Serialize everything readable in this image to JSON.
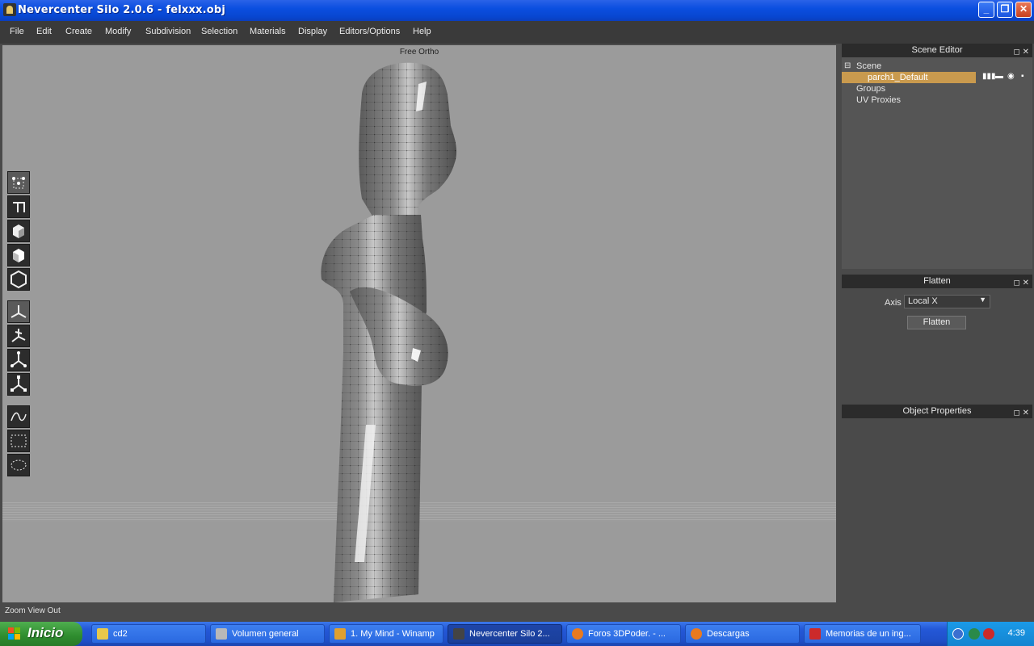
{
  "window": {
    "title": "Nevercenter Silo 2.0.6 - felxxx.obj"
  },
  "menu": [
    "File",
    "Edit",
    "Create",
    "Modify",
    "Subdivision",
    "Selection",
    "Materials",
    "Display",
    "Editors/Options",
    "Help"
  ],
  "viewport": {
    "label": "Free Ortho"
  },
  "scene_editor": {
    "title": "Scene Editor",
    "items": [
      {
        "label": "Scene",
        "toggle": "⊟"
      },
      {
        "label": "parch1_Default",
        "selected": true
      },
      {
        "label": "Groups"
      },
      {
        "label": "UV Proxies"
      }
    ]
  },
  "flatten": {
    "title": "Flatten",
    "axis_label": "Axis",
    "axis_value": "Local X",
    "button_label": "Flatten"
  },
  "object_properties": {
    "title": "Object Properties"
  },
  "status": {
    "text": "Zoom View Out"
  },
  "taskbar": {
    "start_label": "Inicio",
    "tasks": [
      {
        "label": "cd2",
        "icon_color": "#e8c84a"
      },
      {
        "label": "Volumen general",
        "icon_color": "#b8b8b8"
      },
      {
        "label": "1. My Mind - Winamp",
        "icon_color": "#e0a030"
      },
      {
        "label": "Nevercenter Silo 2...",
        "icon_color": "#444444",
        "active": true
      },
      {
        "label": "Foros 3DPoder. - ...",
        "icon_color": "#e87a20"
      },
      {
        "label": "Descargas",
        "icon_color": "#e87a20"
      },
      {
        "label": "Memorias de un ing...",
        "icon_color": "#cc2a2a"
      }
    ],
    "clock": "4:39"
  },
  "colors": {
    "selection": "#c99a4e",
    "viewport": "#9b9b9b",
    "panel": "#555555"
  }
}
